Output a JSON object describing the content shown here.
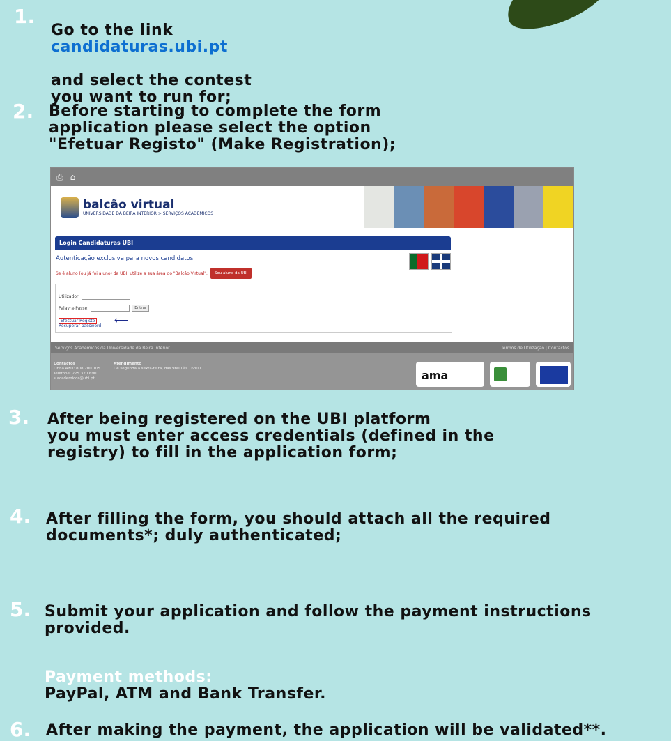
{
  "steps": [
    {
      "num": "1.",
      "text_before": "Go to the link",
      "link": "candidaturas.ubi.pt",
      "text_after": "and select the contest\nyou want to run for;"
    },
    {
      "num": "2.",
      "text": "Before starting to complete the form\napplication please select the option\n\"Efetuar Registo\" (Make Registration);"
    },
    {
      "num": "3.",
      "text": "After being registered on the UBI platform\nyou must enter access credentials (defined in the\nregistry) to fill in the application form;"
    },
    {
      "num": "4.",
      "text": "After filling the form, you should attach all the required\ndocuments*; duly authenticated;"
    },
    {
      "num": "5.",
      "text": "Submit your application and follow the payment instructions\nprovided."
    },
    {
      "num": "6.",
      "text": "After making the payment, the application will be validated**."
    }
  ],
  "payment": {
    "label": "Payment methods:",
    "value": "PayPal, ATM and Bank Transfer."
  },
  "colors": {
    "background": "#b5e4e4",
    "link": "#0d6fd1",
    "accent_white": "#ffffff",
    "leaf": "#2d4a18"
  },
  "screenshot": {
    "topbar_icons": [
      "print-icon",
      "home-icon"
    ],
    "brand_title": "balcão virtual",
    "brand_sub": "UNIVERSIDADE DA BEIRA INTERIOR > SERVIÇOS ACADÉMICOS",
    "login_title": "Login Candidaturas UBI",
    "login_heading": "Autenticação exclusiva para novos candidatos.",
    "login_warning": "Se é aluno (ou já foi aluno) da UBI, utilize a sua área do \"Balcão Virtual\".",
    "student_button": "Sou aluno da UBI",
    "user_label": "Utilizador:",
    "password_label": "Palavra-Passe:",
    "enter_button": "Entrar",
    "register_link": "Efectuar Registo",
    "recover_link": "Recuperar password",
    "footer_left": "Serviços Académicos da Universidade da Beira Interior",
    "footer_right": "Termos de Utilização | Contactos",
    "contacts_title": "Contactos",
    "contacts_line1": "Linha Azul: 808 200 105",
    "contacts_line2": "Telefone: 275 320 690",
    "contacts_line3": "s.academicos@ubi.pt",
    "hours_title": "Atendimento",
    "hours_line": "De segunda a sexta-feira, das 9h00 às 16h00",
    "ama_logo": "ama"
  }
}
